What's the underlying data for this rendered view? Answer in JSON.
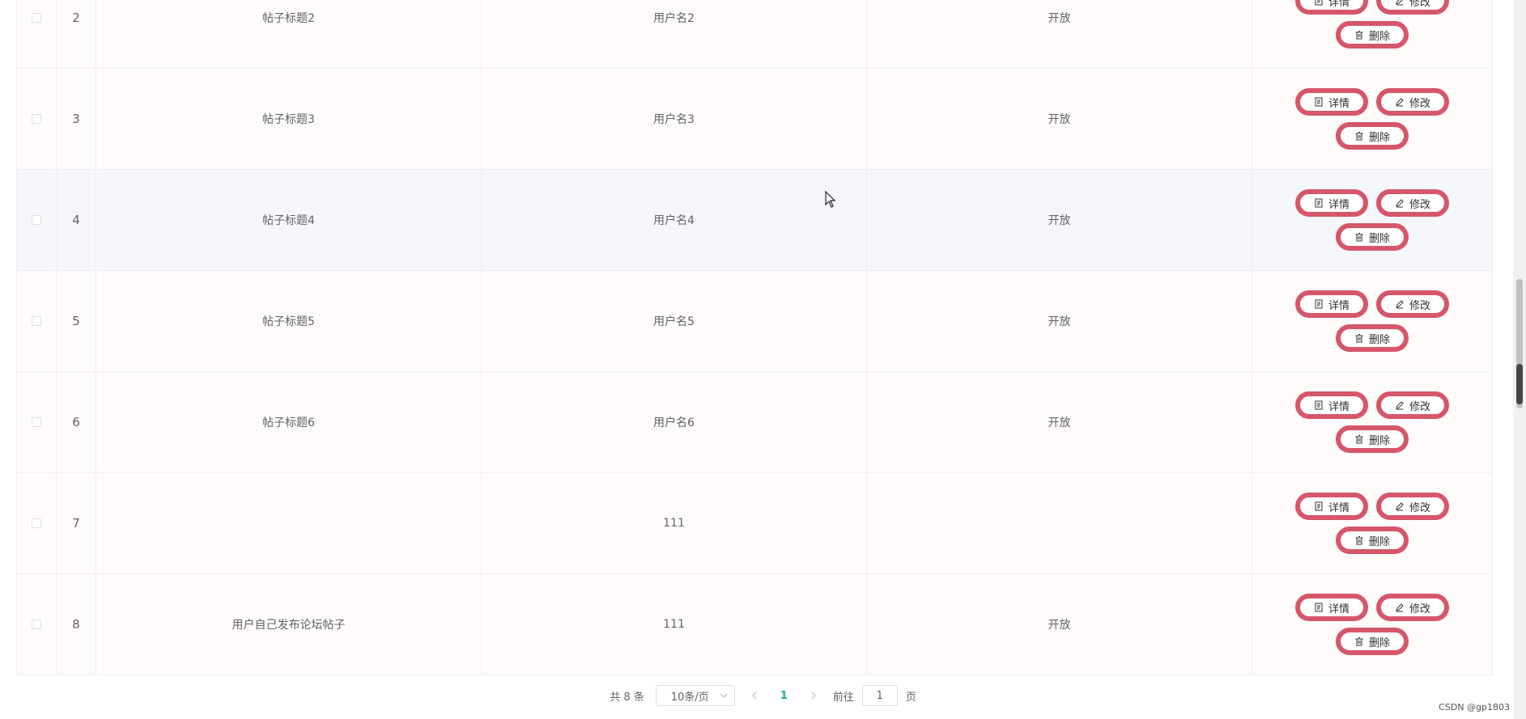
{
  "table": {
    "rows": [
      {
        "index": "2",
        "title": "帖子标题2",
        "user": "用户名2",
        "status": "开放"
      },
      {
        "index": "3",
        "title": "帖子标题3",
        "user": "用户名3",
        "status": "开放"
      },
      {
        "index": "4",
        "title": "帖子标题4",
        "user": "用户名4",
        "status": "开放"
      },
      {
        "index": "5",
        "title": "帖子标题5",
        "user": "用户名5",
        "status": "开放"
      },
      {
        "index": "6",
        "title": "帖子标题6",
        "user": "用户名6",
        "status": "开放"
      },
      {
        "index": "7",
        "title": "",
        "user": "111",
        "status": ""
      },
      {
        "index": "8",
        "title": "用户自己发布论坛帖子",
        "user": "111",
        "status": "开放"
      }
    ],
    "actions": {
      "detail_label": "详情",
      "edit_label": "修改",
      "delete_label": "删除"
    }
  },
  "pagination": {
    "total_text": "共 8 条",
    "page_size": "10条/页",
    "current_page": "1",
    "goto_label": "前往",
    "goto_value": "1",
    "page_suffix": "页"
  },
  "watermark": "CSDN @gp1803",
  "colors": {
    "button_border": "#d6566a",
    "active_page": "#1aaf8c",
    "row_bg": "#fffbfb",
    "row_hover_bg": "#f5f7fa"
  }
}
